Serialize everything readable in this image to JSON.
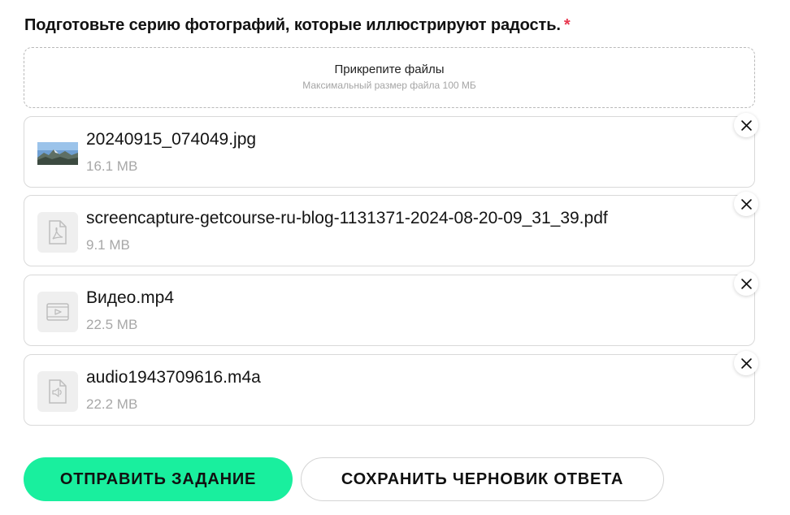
{
  "form": {
    "question": "Подготовьте серию фотографий, которые иллюстрируют радость.",
    "required_mark": "*"
  },
  "dropzone": {
    "title": "Прикрепите файлы",
    "subtitle": "Максимальный размер файла 100 МБ"
  },
  "files": [
    {
      "name": "20240915_074049.jpg",
      "size": "16.1 MB",
      "icon": "image-thumbnail"
    },
    {
      "name": "screencapture-getcourse-ru-blog-1131371-2024-08-20-09_31_39.pdf",
      "size": "9.1 MB",
      "icon": "pdf-icon"
    },
    {
      "name": "Видео.mp4",
      "size": "22.5 MB",
      "icon": "video-icon"
    },
    {
      "name": "audio1943709616.m4a",
      "size": "22.2 MB",
      "icon": "audio-icon"
    }
  ],
  "actions": {
    "submit_label": "ОТПРАВИТЬ ЗАДАНИЕ",
    "draft_label": "СОХРАНИТЬ ЧЕРНОВИК ОТВЕТА"
  },
  "colors": {
    "accent": "#19ef9e",
    "required": "#e8384f",
    "muted_text": "#a7a7a7",
    "border": "#d9d9d9"
  }
}
